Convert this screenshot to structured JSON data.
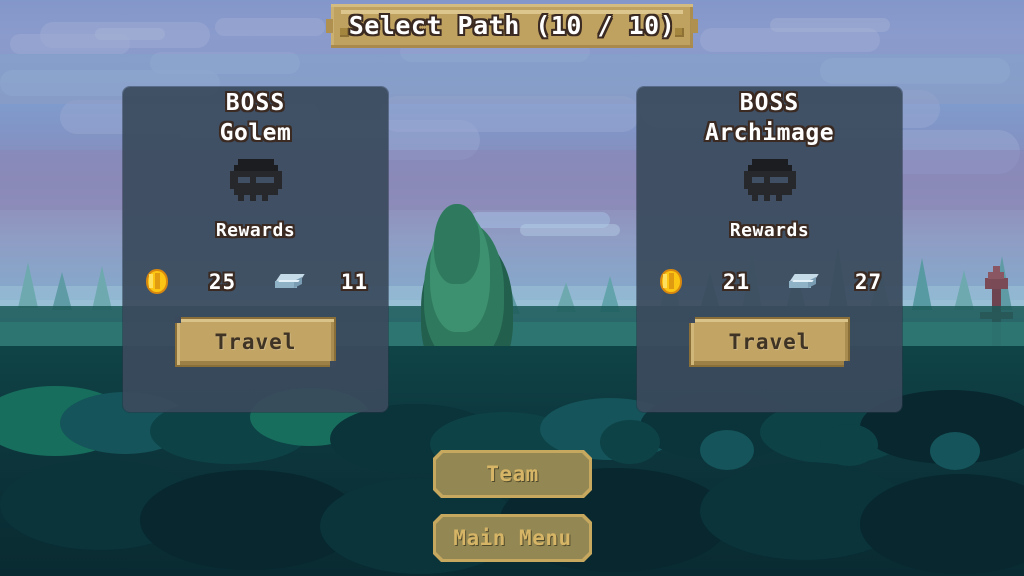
{
  "screen": {
    "title": "Select Path",
    "progress": "(10 / 10)",
    "banner_label": "Select Path (10 / 10)",
    "background": {
      "scene": "pixel-art forest at dusk",
      "sky_top_color": "#6f9ad4",
      "sky_haze_color": "#8b86b6",
      "canopy_color": "#0d4247",
      "tree_color": "#2f7a5e"
    }
  },
  "theme": {
    "banner_gold": "#c0a260",
    "card_bg": "#3a4a5c",
    "button_gold": "#c2a465",
    "menu_border_gold": "#c7a85f",
    "menu_text_gold": "#d6b566",
    "text_white": "#ffffff",
    "text_outline": "#3a2a22",
    "coin_gold": "#fcc513",
    "ingot_silver": "#c6dbe8",
    "skull_dark": "#26282c"
  },
  "cards": [
    {
      "kind": "BOSS",
      "name": "Golem",
      "enemy_icon": "skull-icon",
      "rewards_label": "Rewards",
      "rewards": [
        {
          "icon": "gold-coin-icon",
          "type": "gold",
          "amount": "25"
        },
        {
          "icon": "steel-ingot-icon",
          "type": "ingot",
          "amount": "11"
        }
      ],
      "action_label": "Travel"
    },
    {
      "kind": "BOSS",
      "name": "Archimage",
      "enemy_icon": "skull-icon",
      "rewards_label": "Rewards",
      "rewards": [
        {
          "icon": "gold-coin-icon",
          "type": "gold",
          "amount": "21"
        },
        {
          "icon": "steel-ingot-icon",
          "type": "ingot",
          "amount": "27"
        }
      ],
      "action_label": "Travel"
    }
  ],
  "menu": {
    "team_label": "Team",
    "main_menu_label": "Main Menu"
  }
}
